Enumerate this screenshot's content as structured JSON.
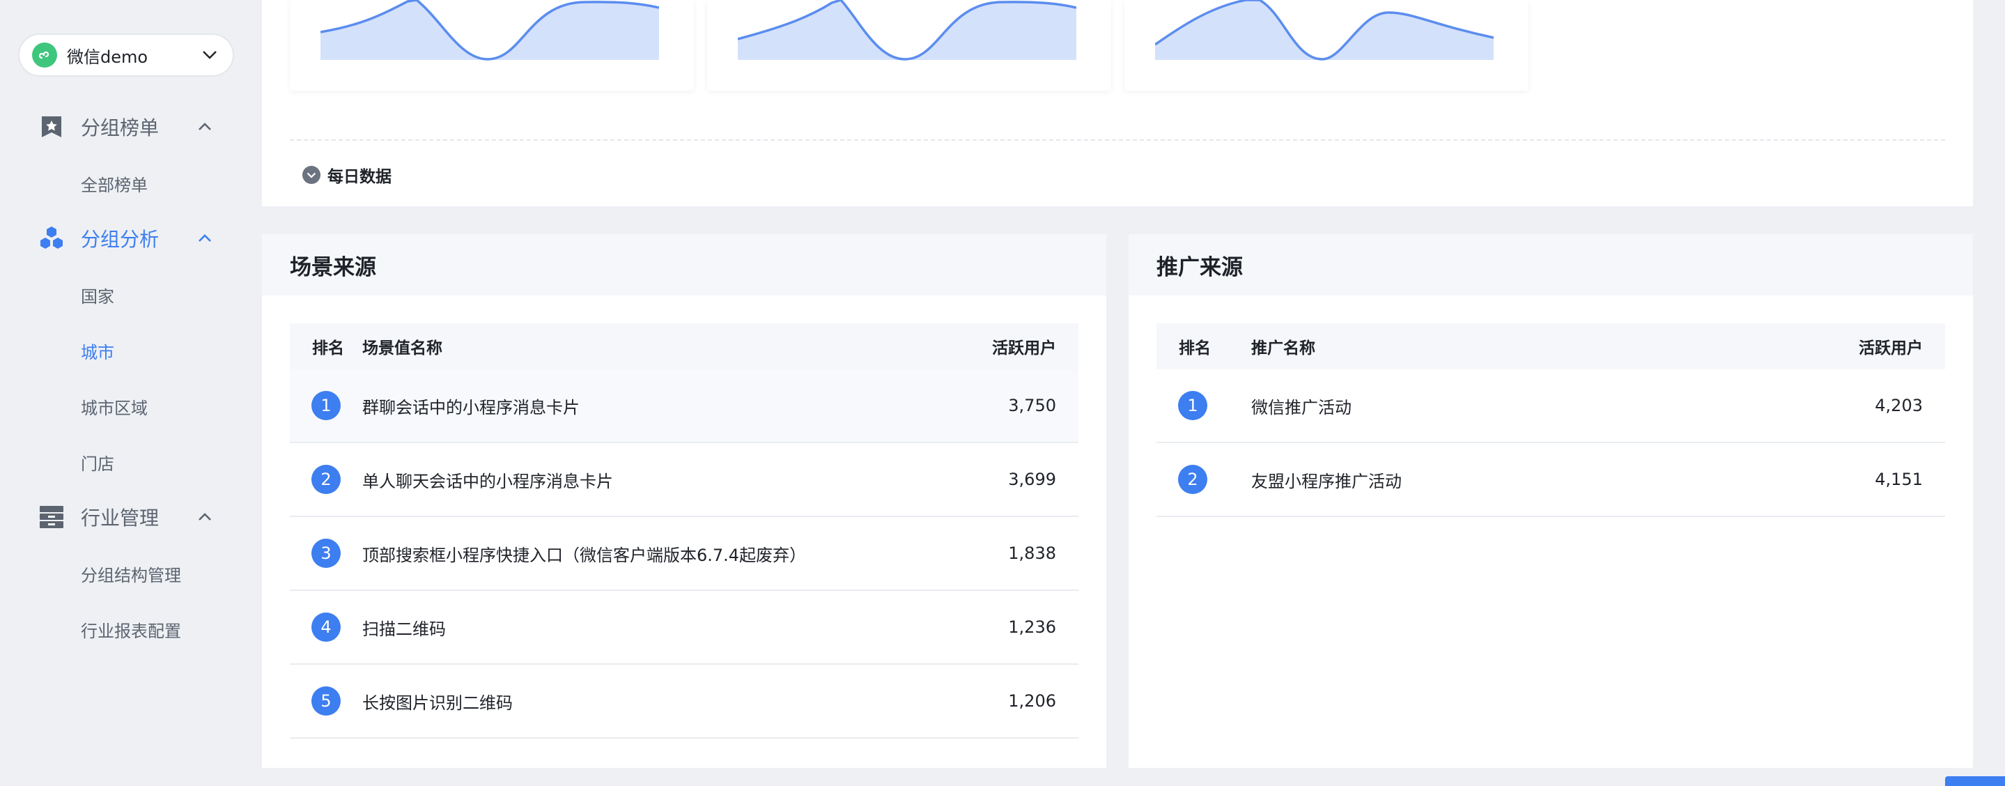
{
  "app_switcher": {
    "name": "微信demo"
  },
  "sidebar": {
    "groups": [
      {
        "label": "分组榜单",
        "icon": "star-bookmark-icon",
        "items": [
          "全部榜单"
        ]
      },
      {
        "label": "分组分析",
        "icon": "hexagon-cluster-icon",
        "items": [
          "国家",
          "城市",
          "城市区域",
          "门店"
        ]
      },
      {
        "label": "行业管理",
        "icon": "archive-box-icon",
        "items": [
          "分组结构管理",
          "行业报表配置"
        ]
      }
    ],
    "active_group": "分组分析",
    "active_item": "城市"
  },
  "daily_toggle": {
    "label": "每日数据"
  },
  "scene_source": {
    "title": "场景来源",
    "columns": {
      "rank": "排名",
      "name": "场景值名称",
      "value": "活跃用户"
    },
    "rows": [
      {
        "rank": "1",
        "name": "群聊会话中的小程序消息卡片",
        "value": "3,750"
      },
      {
        "rank": "2",
        "name": "单人聊天会话中的小程序消息卡片",
        "value": "3,699"
      },
      {
        "rank": "3",
        "name": "顶部搜索框小程序快捷入口（微信客户端版本6.7.4起废弃）",
        "value": "1,838"
      },
      {
        "rank": "4",
        "name": "扫描二维码",
        "value": "1,236"
      },
      {
        "rank": "5",
        "name": "长按图片识别二维码",
        "value": "1,206"
      }
    ]
  },
  "promo_source": {
    "title": "推广来源",
    "columns": {
      "rank": "排名",
      "name": "推广名称",
      "value": "活跃用户"
    },
    "rows": [
      {
        "rank": "1",
        "name": "微信推广活动",
        "value": "4,203"
      },
      {
        "rank": "2",
        "name": "友盟小程序推广活动",
        "value": "4,151"
      }
    ]
  },
  "colors": {
    "accent": "#3d7ef0",
    "sparkline_fill": "#d4e1fb",
    "sparkline_stroke": "#5b8def",
    "logo_green": "#3fc67d"
  }
}
